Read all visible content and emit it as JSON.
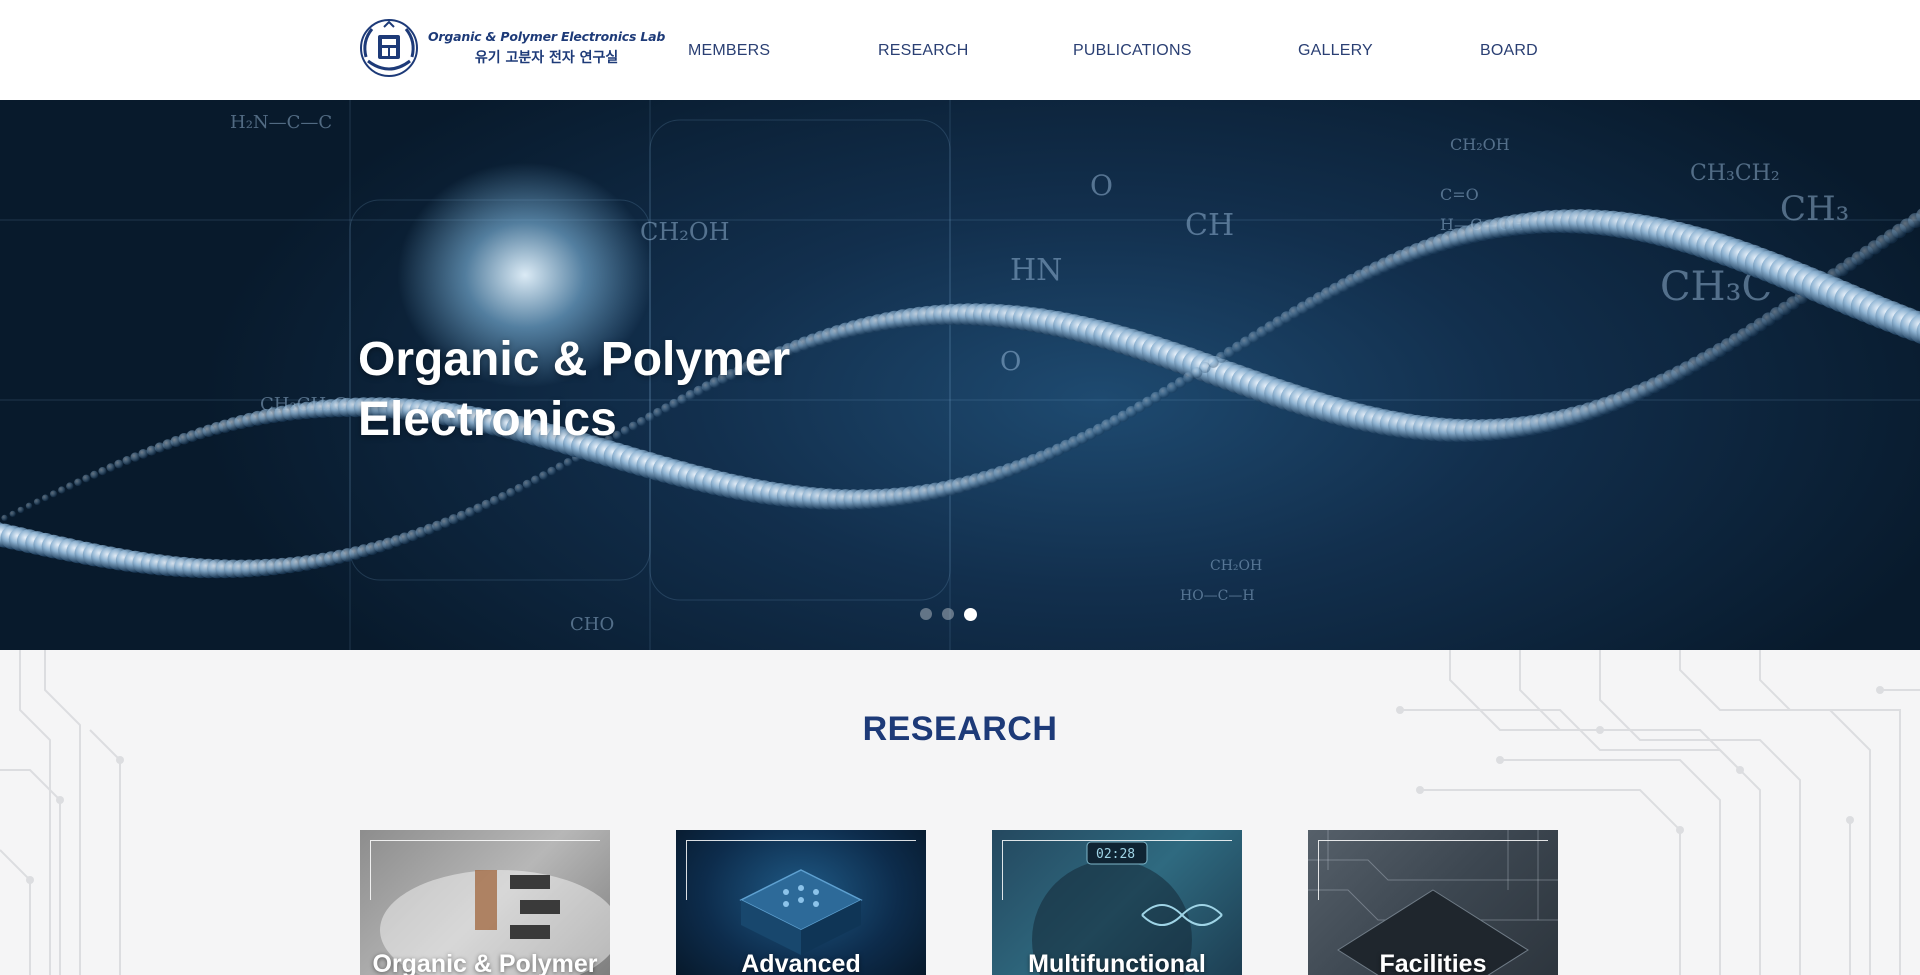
{
  "header": {
    "logo": {
      "title_en": "Organic & Polymer Electronics Lab",
      "title_ko": "유기 고분자 전자 연구실"
    },
    "nav": [
      "MEMBERS",
      "RESEARCH",
      "PUBLICATIONS",
      "GALLERY",
      "BOARD"
    ]
  },
  "hero": {
    "title_line1": "Organic & Polymer",
    "title_line2": "Electronics",
    "slides_total": 3,
    "active_slide": 3
  },
  "research": {
    "title": "RESEARCH",
    "cards": [
      {
        "label": "Organic & Polymer"
      },
      {
        "label": "Advanced"
      },
      {
        "label": "Multifunctional"
      },
      {
        "label": "Facilities"
      }
    ]
  },
  "colors": {
    "brand": "#1d3a78",
    "nav_text": "#2a3f73",
    "hero_dark": "#0a1c30",
    "section_bg": "#f5f5f6"
  }
}
